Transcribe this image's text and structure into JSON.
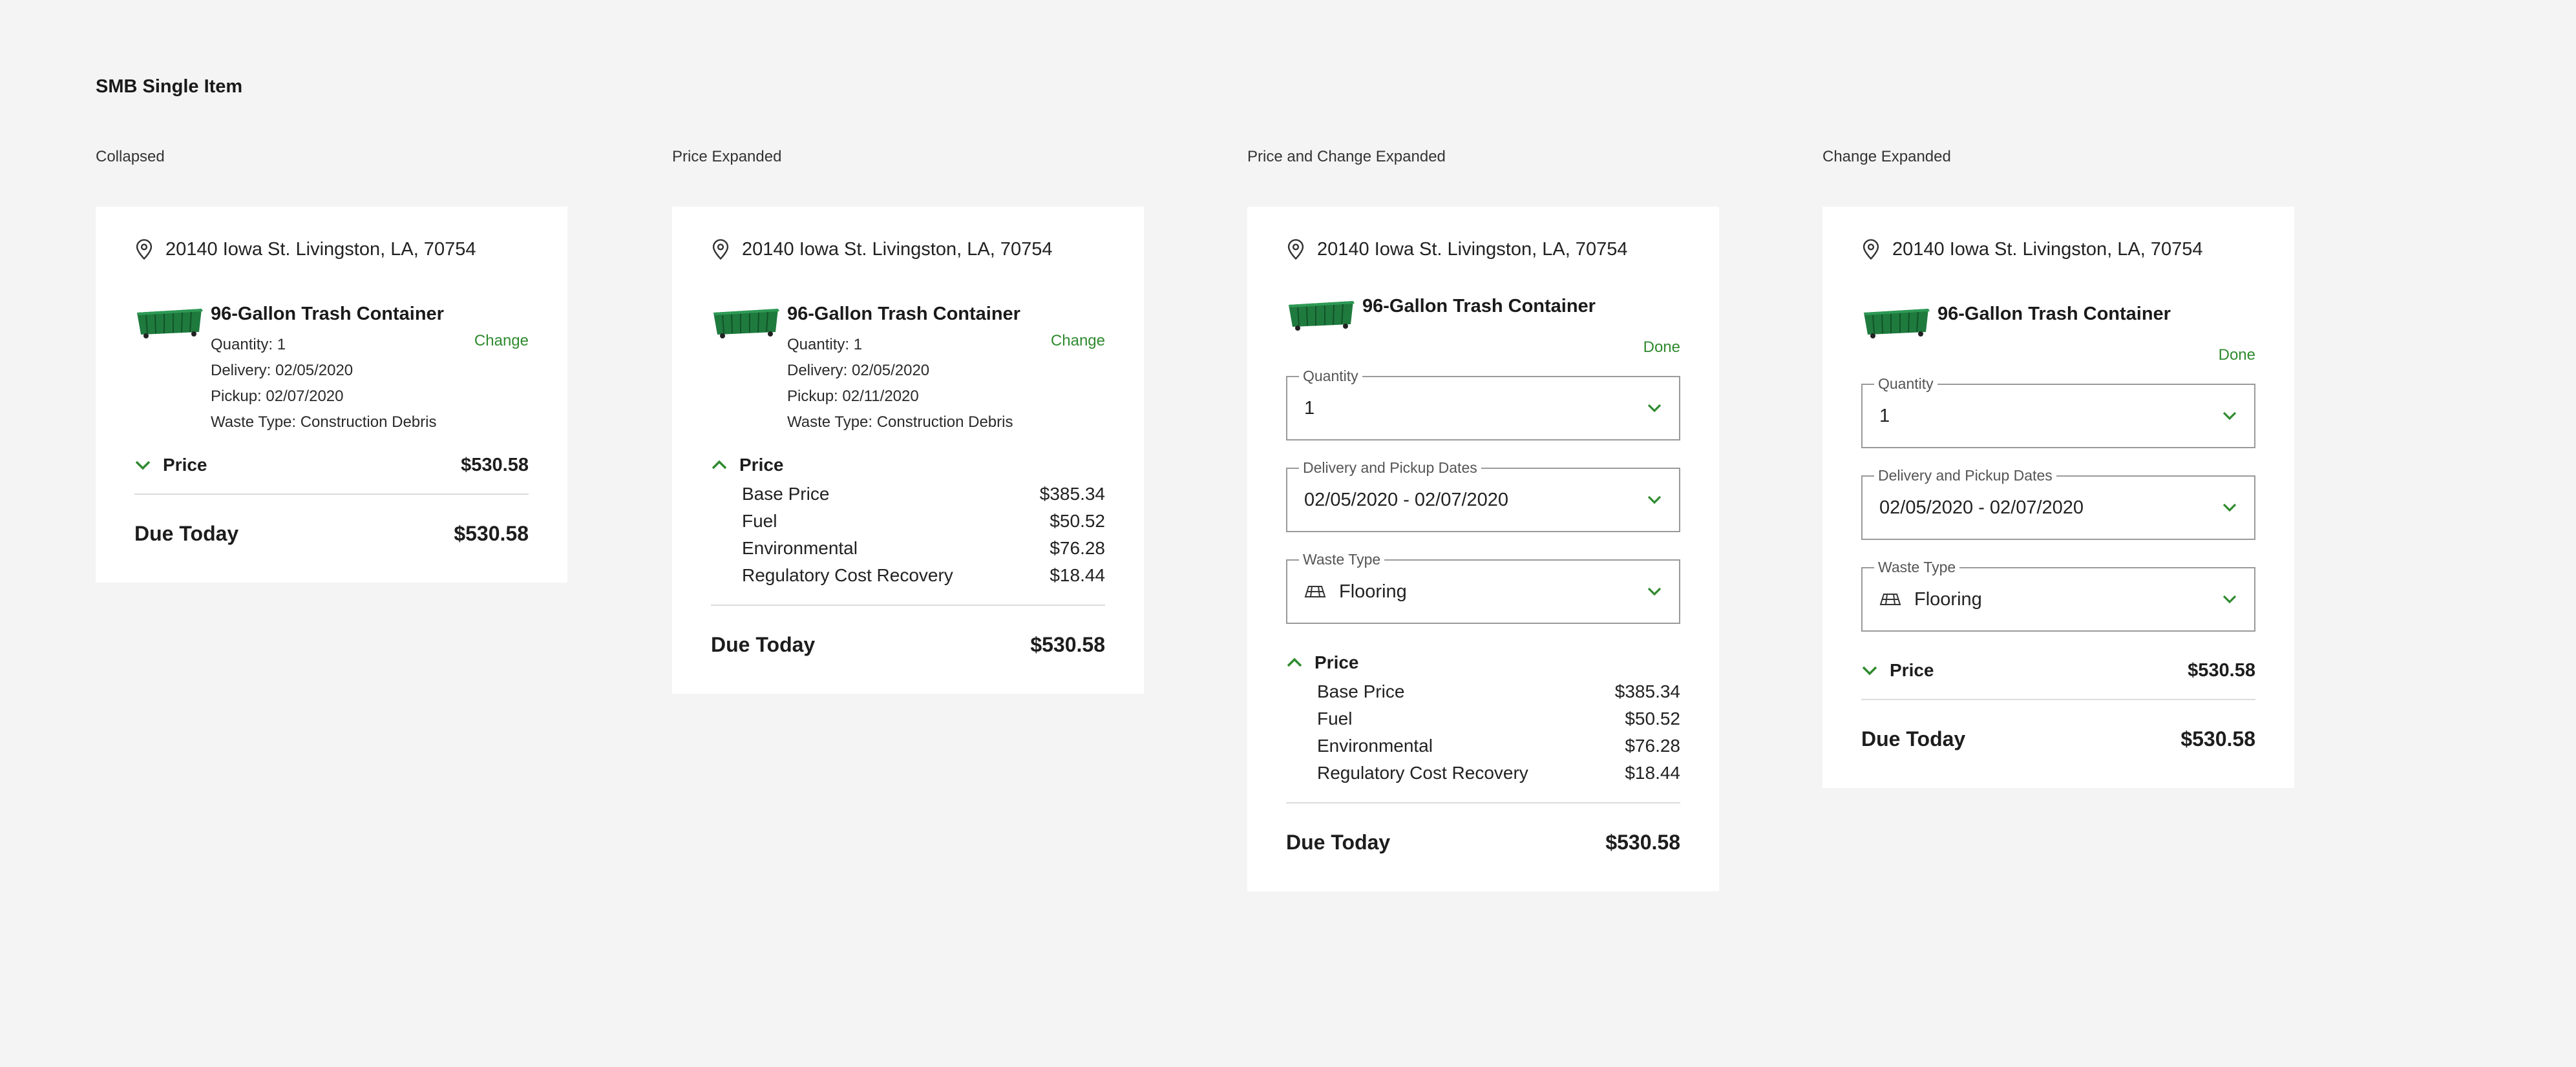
{
  "page": {
    "title": "SMB Single Item"
  },
  "common": {
    "address": "20140 Iowa St. Livingston, LA, 70754",
    "item_title": "96-Gallon Trash Container",
    "price_label": "Price",
    "price_total": "$530.58",
    "due_label": "Due Today",
    "due_total": "$530.58",
    "change_label": "Change",
    "done_label": "Done"
  },
  "variants": [
    {
      "label": "Collapsed",
      "details": [
        "Quantity: 1",
        "Delivery: 02/05/2020",
        "Pickup: 02/07/2020",
        "Waste Type: Construction Debris"
      ]
    },
    {
      "label": "Price Expanded",
      "details": [
        "Quantity: 1",
        "Delivery: 02/05/2020",
        "Pickup: 02/11/2020",
        "Waste Type: Construction Debris"
      ]
    },
    {
      "label": "Price and Change Expanded"
    },
    {
      "label": "Change Expanded"
    }
  ],
  "breakdown": [
    {
      "name": "Base Price",
      "amount": "$385.34"
    },
    {
      "name": "Fuel",
      "amount": "$50.52"
    },
    {
      "name": "Environmental",
      "amount": "$76.28"
    },
    {
      "name": "Regulatory Cost Recovery",
      "amount": "$18.44"
    }
  ],
  "fields": {
    "quantity": {
      "label": "Quantity",
      "value": "1"
    },
    "dates": {
      "label": "Delivery and Pickup Dates",
      "value": "02/05/2020 - 02/07/2020"
    },
    "waste": {
      "label": "Waste Type",
      "value": "Flooring"
    }
  },
  "colors": {
    "accent": "#2f8a2f",
    "container": "#1f7a3e",
    "background": "#f4f4f4",
    "card": "#ffffff"
  },
  "icons": {
    "pin": "map-pin-icon",
    "chevron_down": "chevron-down-icon",
    "chevron_up": "chevron-up-icon",
    "waste": "flooring-icon"
  }
}
